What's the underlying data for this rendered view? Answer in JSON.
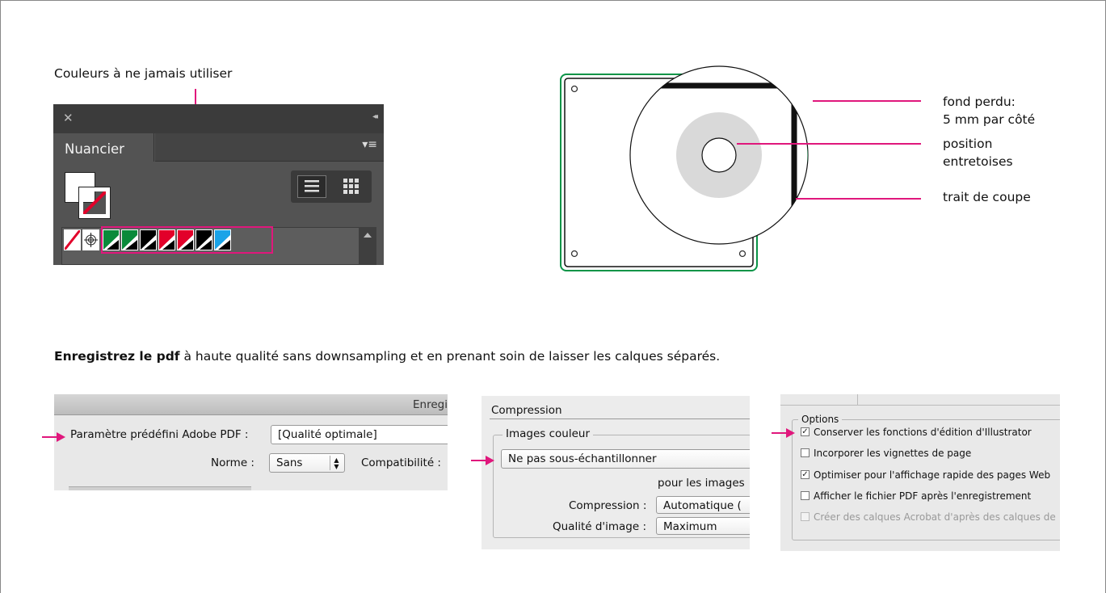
{
  "section1": {
    "caption": "Couleurs à ne jamais utiliser",
    "panel": {
      "close_glyph": "✕",
      "collapse_glyph": "◂◂",
      "tab_label": "Nuancier",
      "menu_glyph": "▾≡"
    },
    "swatch_colors": [
      "#ffffff",
      "#ffffff",
      "#0a8a3a",
      "#0a8a3a",
      "#000000",
      "#e2002a",
      "#e2002a",
      "#000000",
      "#1aa3e8"
    ]
  },
  "diagram": {
    "label_bleed_line1": "fond perdu:",
    "label_bleed_line2": "5 mm par côté",
    "label_spacer_line1": "position",
    "label_spacer_line2": "entretoises",
    "label_cut": "trait de coupe"
  },
  "instruction": {
    "bold": "Enregistrez le pdf",
    "rest": " à haute qualité sans downsampling et en prenant soin de laisser les calques séparés."
  },
  "dialog1": {
    "title_fragment": "Enregi",
    "preset_label": "Paramètre prédéfini Adobe PDF :",
    "preset_value": "[Qualité optimale]",
    "norm_label": "Norme :",
    "norm_value": "Sans",
    "compat_label": "Compatibilité :"
  },
  "dialog2": {
    "section_title": "Compression",
    "group_title": "Images couleur",
    "downsample_value": "Ne pas sous-échantillonner",
    "for_images": "pour les images",
    "compression_label": "Compression :",
    "compression_value": "Automatique (",
    "quality_label": "Qualité d'image :",
    "quality_value": "Maximum"
  },
  "dialog3": {
    "group_title": "Options",
    "options": [
      {
        "label": "Conserver les fonctions d'édition d'Illustrator",
        "checked": true
      },
      {
        "label": "Incorporer les vignettes de page",
        "checked": false
      },
      {
        "label": "Optimiser pour l'affichage rapide des pages Web",
        "checked": true
      },
      {
        "label": "Afficher le fichier PDF après l'enregistrement",
        "checked": false
      },
      {
        "label": "Créer des calques Acrobat d'après des calques de",
        "checked": false
      }
    ]
  },
  "colors": {
    "accent_pink": "#e0177c",
    "bleed_green": "#0a9447"
  }
}
